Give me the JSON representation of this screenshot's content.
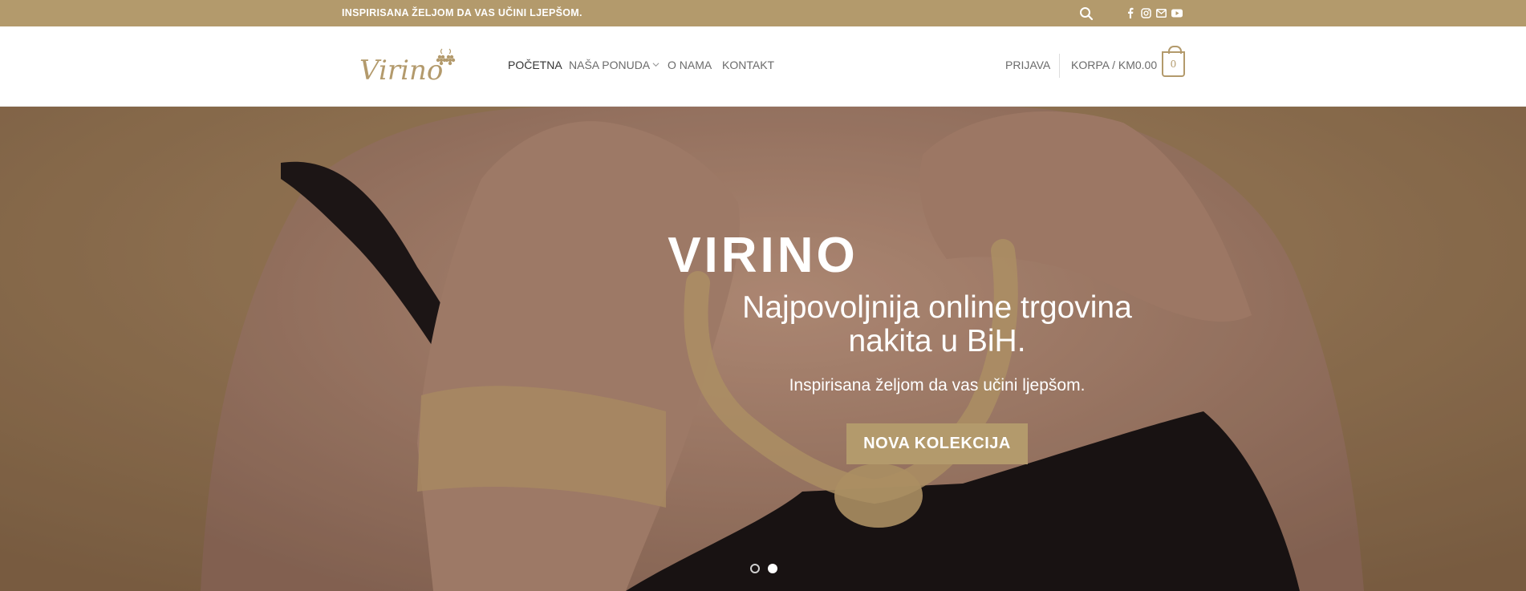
{
  "topbar": {
    "tagline": "INSPIRISANA ŽELJOM DA VAS UČINI LJEPŠOM.",
    "icons": [
      "search-icon",
      "facebook-icon",
      "instagram-icon",
      "email-icon",
      "youtube-icon"
    ]
  },
  "header": {
    "logo_text": "Virino",
    "nav": [
      {
        "label": "POČETNA",
        "active": true
      },
      {
        "label": "NAŠA PONUDA",
        "dropdown": true
      },
      {
        "label": "O NAMA"
      },
      {
        "label": "KONTAKT"
      }
    ],
    "login_label": "PRIJAVA",
    "cart_label": "KORPA / KM0.00",
    "cart_count": "0"
  },
  "hero": {
    "title": "VIRINO",
    "subtitle_line1": "Najpovoljnija online trgovina",
    "subtitle_line2": "nakita u BiH.",
    "text": "Inspirisana željom da vas učini ljepšom.",
    "button_label": "NOVA KOLEKCIJA",
    "slides": 2,
    "active_slide": 2
  },
  "colors": {
    "accent": "#b39a6c",
    "nav_text": "#6b6b6b",
    "nav_active": "#333333"
  }
}
